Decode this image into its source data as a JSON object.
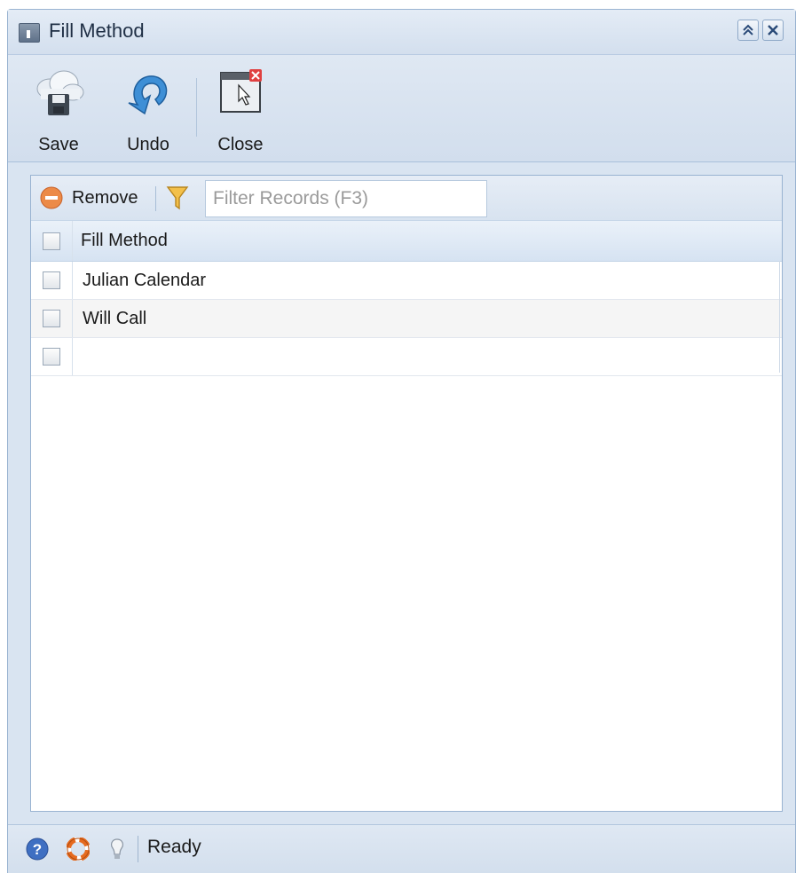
{
  "window": {
    "title": "Fill Method"
  },
  "toolbar": {
    "save_label": "Save",
    "undo_label": "Undo",
    "close_label": "Close"
  },
  "grid_toolbar": {
    "remove_label": "Remove",
    "filter_placeholder": "Filter Records (F3)"
  },
  "grid": {
    "column_header": "Fill Method",
    "rows": [
      {
        "value": "Julian Calendar",
        "checked": false
      },
      {
        "value": "Will Call",
        "checked": false
      },
      {
        "value": "",
        "checked": false
      }
    ]
  },
  "statusbar": {
    "status": "Ready"
  },
  "icons": {
    "window": "window-info-icon",
    "collapse": "collapse-icon",
    "close_window": "close-icon",
    "save": "cloud-save-icon",
    "undo": "undo-arrow-icon",
    "close": "close-window-icon",
    "remove": "remove-icon",
    "filter": "filter-icon",
    "help": "help-icon",
    "support": "lifebuoy-icon",
    "tip": "lightbulb-icon"
  },
  "colors": {
    "accent": "#4a90d9",
    "remove": "#e8793a",
    "filter": "#f0b030"
  }
}
